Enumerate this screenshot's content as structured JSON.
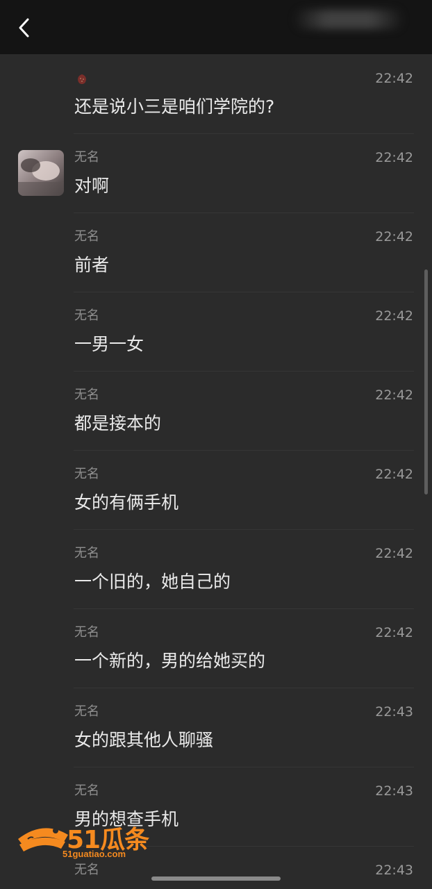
{
  "messages": [
    {
      "name": "",
      "time": "22:42",
      "text": "还是说小三是咱们学院的?"
    },
    {
      "name": "无名",
      "time": "22:42",
      "text": "对啊"
    },
    {
      "name": "无名",
      "time": "22:42",
      "text": "前者"
    },
    {
      "name": "无名",
      "time": "22:42",
      "text": "一男一女"
    },
    {
      "name": "无名",
      "time": "22:42",
      "text": "都是接本的"
    },
    {
      "name": "无名",
      "time": "22:42",
      "text": "女的有俩手机"
    },
    {
      "name": "无名",
      "time": "22:42",
      "text": "一个旧的，她自己的"
    },
    {
      "name": "无名",
      "time": "22:42",
      "text": "一个新的，男的给她买的"
    },
    {
      "name": "无名",
      "time": "22:43",
      "text": "女的跟其他人聊骚"
    },
    {
      "name": "无名",
      "time": "22:43",
      "text": "男的想查手机"
    },
    {
      "name": "无名",
      "time": "22:43",
      "text": ""
    }
  ],
  "watermark": {
    "brand": "51瓜条",
    "url": "51guatiao.com"
  },
  "colors": {
    "background": "#2b2b2b",
    "topbar": "#141414",
    "accent": "#f58a1f"
  }
}
